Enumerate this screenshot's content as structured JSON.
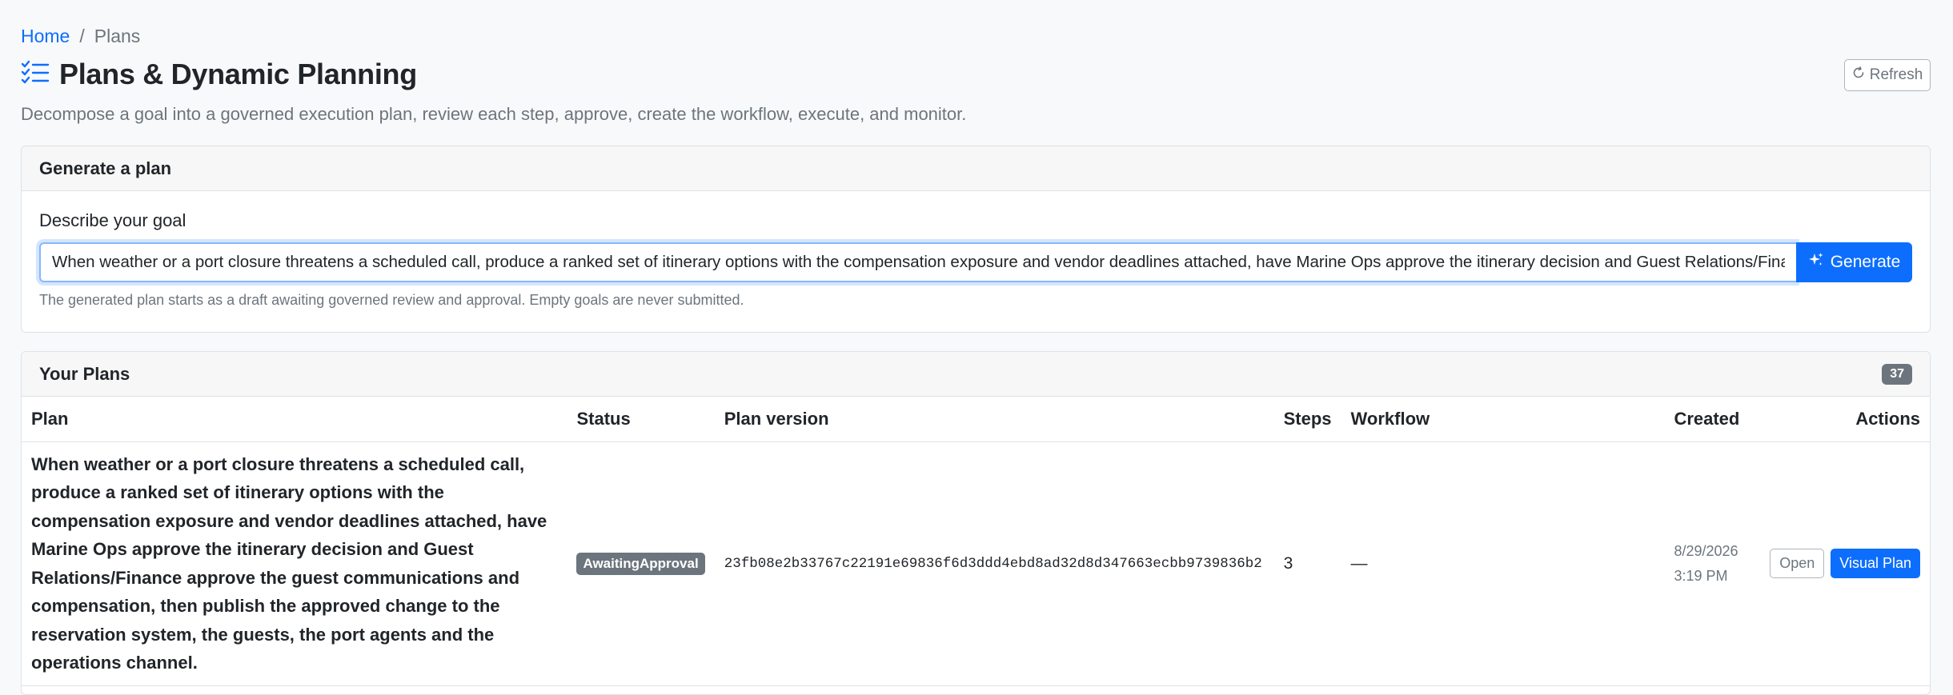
{
  "breadcrumb": {
    "home": "Home",
    "separator": "/",
    "current": "Plans"
  },
  "header": {
    "icon": "list-check-icon",
    "title": "Plans & Dynamic Planning",
    "subtitle": "Decompose a goal into a governed execution plan, review each step, approve, create the workflow, execute, and monitor.",
    "refresh_label": "Refresh"
  },
  "generate": {
    "card_title": "Generate a plan",
    "goal_label": "Describe your goal",
    "goal_value": "When weather or a port closure threatens a scheduled call, produce a ranked set of itinerary options with the compensation exposure and vendor deadlines attached, have Marine Ops approve the itinerary decision and Guest Relations/Finance approve the guest communications and compensation, then publish the approved change to the reservation system, the guests, the port agents and the operations channel.",
    "button_label": "Generate",
    "help_text": "The generated plan starts as a draft awaiting governed review and approval. Empty goals are never submitted."
  },
  "plans": {
    "card_title": "Your Plans",
    "count": "37",
    "columns": {
      "plan": "Plan",
      "status": "Status",
      "version": "Plan version",
      "steps": "Steps",
      "workflow": "Workflow",
      "created": "Created",
      "actions": "Actions"
    },
    "rows": [
      {
        "plan": "When weather or a port closure threatens a scheduled call, produce a ranked set of itinerary options with the compensation exposure and vendor deadlines attached, have Marine Ops approve the itinerary decision and Guest Relations/Finance approve the guest communications and compensation, then publish the approved change to the reservation system, the guests, the port agents and the operations channel.",
        "status": "AwaitingApproval",
        "version": "23fb08e2b33767c22191e69836f6d3ddd4ebd8ad32d8d347663ecbb9739836b2",
        "steps": "3",
        "workflow": "—",
        "created_date": "8/29/2026",
        "created_time": "3:19 PM",
        "open_label": "Open",
        "visual_label": "Visual Plan"
      }
    ]
  },
  "colors": {
    "primary": "#0d6efd",
    "secondary": "#6c757d",
    "background": "#f8f9fa"
  }
}
